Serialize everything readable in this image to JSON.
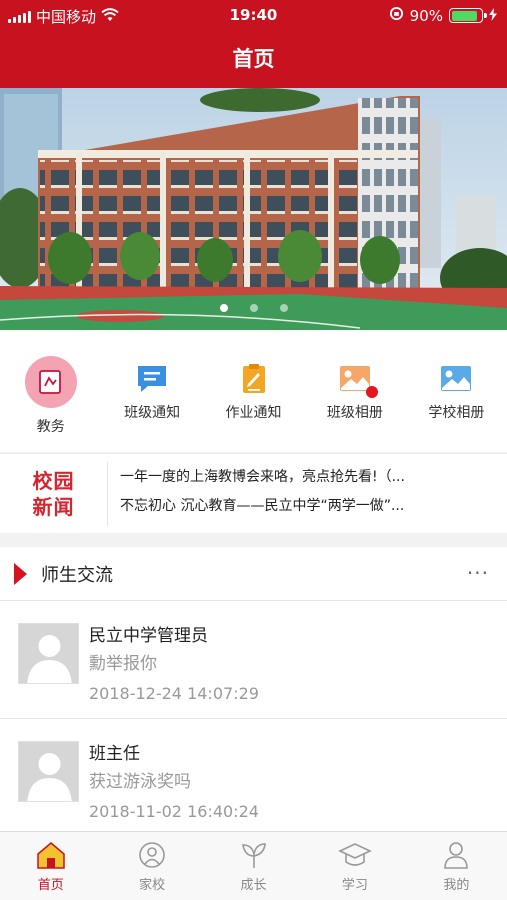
{
  "status_bar": {
    "carrier": "中国移动",
    "time": "19:40",
    "battery": "90%"
  },
  "header": {
    "title": "首页"
  },
  "banner": {
    "slide_count": 3,
    "active_slide": 1
  },
  "quick_menu": [
    {
      "label": "教务",
      "icon": "academic-affairs-icon"
    },
    {
      "label": "班级通知",
      "icon": "class-notice-icon"
    },
    {
      "label": "作业通知",
      "icon": "homework-notice-icon"
    },
    {
      "label": "班级相册",
      "icon": "class-album-icon",
      "badge": true
    },
    {
      "label": "学校相册",
      "icon": "school-album-icon"
    }
  ],
  "campus_news": {
    "logo_line1": "校园",
    "logo_line2": "新闻",
    "items": [
      "一年一度的上海教博会来咯，亮点抢先看!（...",
      "不忘初心 沉心教育——民立中学“两学一做”..."
    ]
  },
  "teacher_student": {
    "title": "师生交流",
    "more": "···",
    "posts": [
      {
        "name": "民立中学管理员",
        "text": "勳举报你",
        "time": "2018-12-24 14:07:29"
      },
      {
        "name": "班主任",
        "text": "获过游泳奖吗",
        "time": "2018-11-02 16:40:24"
      }
    ]
  },
  "tab_bar": [
    {
      "label": "首页",
      "icon": "home-icon",
      "active": true
    },
    {
      "label": "家校",
      "icon": "home-school-icon"
    },
    {
      "label": "成长",
      "icon": "growth-sprout-icon"
    },
    {
      "label": "学习",
      "icon": "graduation-cap-icon"
    },
    {
      "label": "我的",
      "icon": "profile-icon"
    }
  ],
  "colors": {
    "brand_red": "#c8121f",
    "news_red": "#d5252f",
    "badge_red": "#e5141f",
    "battery_green": "#4cd964"
  }
}
